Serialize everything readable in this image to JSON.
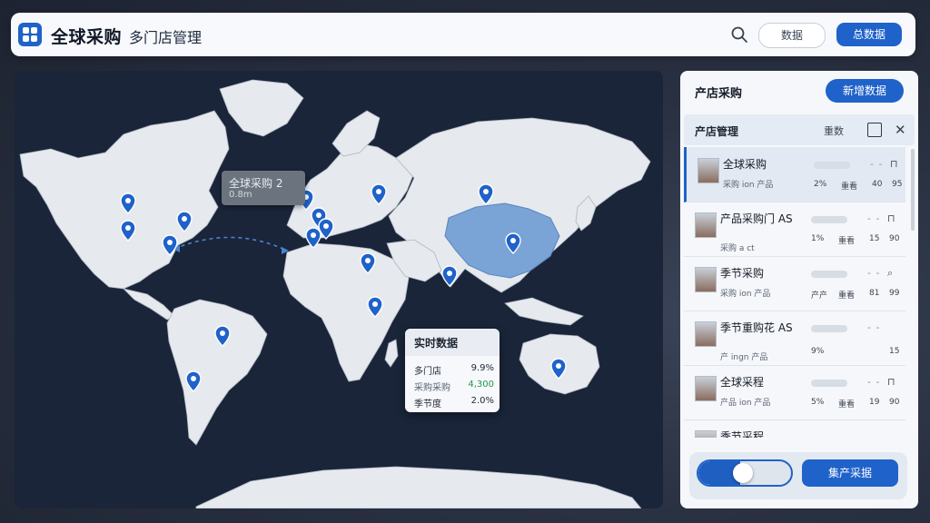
{
  "app": {
    "title": "全球采购",
    "subtitle": "多门店管理"
  },
  "header": {
    "secondary_label": "数据",
    "primary_label": "总数据"
  },
  "colors": {
    "accent": "#1f62c9",
    "map_bg": "#1a2539",
    "land": "#e6e9ee",
    "highlight": "#7aa3d6"
  },
  "map": {
    "tooltip": {
      "title": "全球采购 2",
      "value": "0.8m"
    },
    "stat_card": {
      "title": "实时数据",
      "rows": [
        {
          "label": "多门店",
          "value": "9.9%"
        },
        {
          "label": "采购采购",
          "value": "4,300"
        },
        {
          "label": "季节度",
          "value": "2.0%"
        }
      ]
    },
    "pins": [
      "north-america-west",
      "north-america-central",
      "north-america-east",
      "north-america-south",
      "europe-north",
      "europe-west",
      "europe-central",
      "europe-south",
      "russia",
      "asia-central",
      "china-east",
      "india",
      "africa-north",
      "africa-east",
      "south-america-north",
      "south-america-south",
      "australia"
    ]
  },
  "panel": {
    "title": "产店采购",
    "action_label": "新增数据",
    "subheader": {
      "label": "产店管理",
      "sort_label": "重数"
    },
    "items": [
      {
        "name": "全球采购",
        "sub": "采购 ion 产品",
        "c1": "2%",
        "c2": "重看",
        "c3": "40",
        "c4": "95",
        "selected": true
      },
      {
        "name": "产品采购门 AS",
        "sub": "采购 a ct",
        "c1": "1%",
        "c2": "重看",
        "c3": "15",
        "c4": "90",
        "selected": false
      },
      {
        "name": "季节采购",
        "sub": "采购 ion 产品",
        "c1": "产产",
        "c2": "重看",
        "c3": "81",
        "c4": "99",
        "selected": false
      },
      {
        "name": "季节重购花 AS",
        "sub": "产 ingn 产品",
        "c1": "9%",
        "c2": "",
        "c3": "",
        "c4": "15",
        "selected": false
      },
      {
        "name": "全球采程",
        "sub": "产品 ion 产品",
        "c1": "5%",
        "c2": "重看",
        "c3": "19",
        "c4": "90",
        "selected": false
      },
      {
        "name": "季节采程",
        "sub": "",
        "c1": "",
        "c2": "",
        "c3": "",
        "c4": "",
        "selected": false
      }
    ],
    "footer": {
      "toggle_on": true,
      "toggle_level": 0.45,
      "button_label": "集产采据"
    }
  }
}
